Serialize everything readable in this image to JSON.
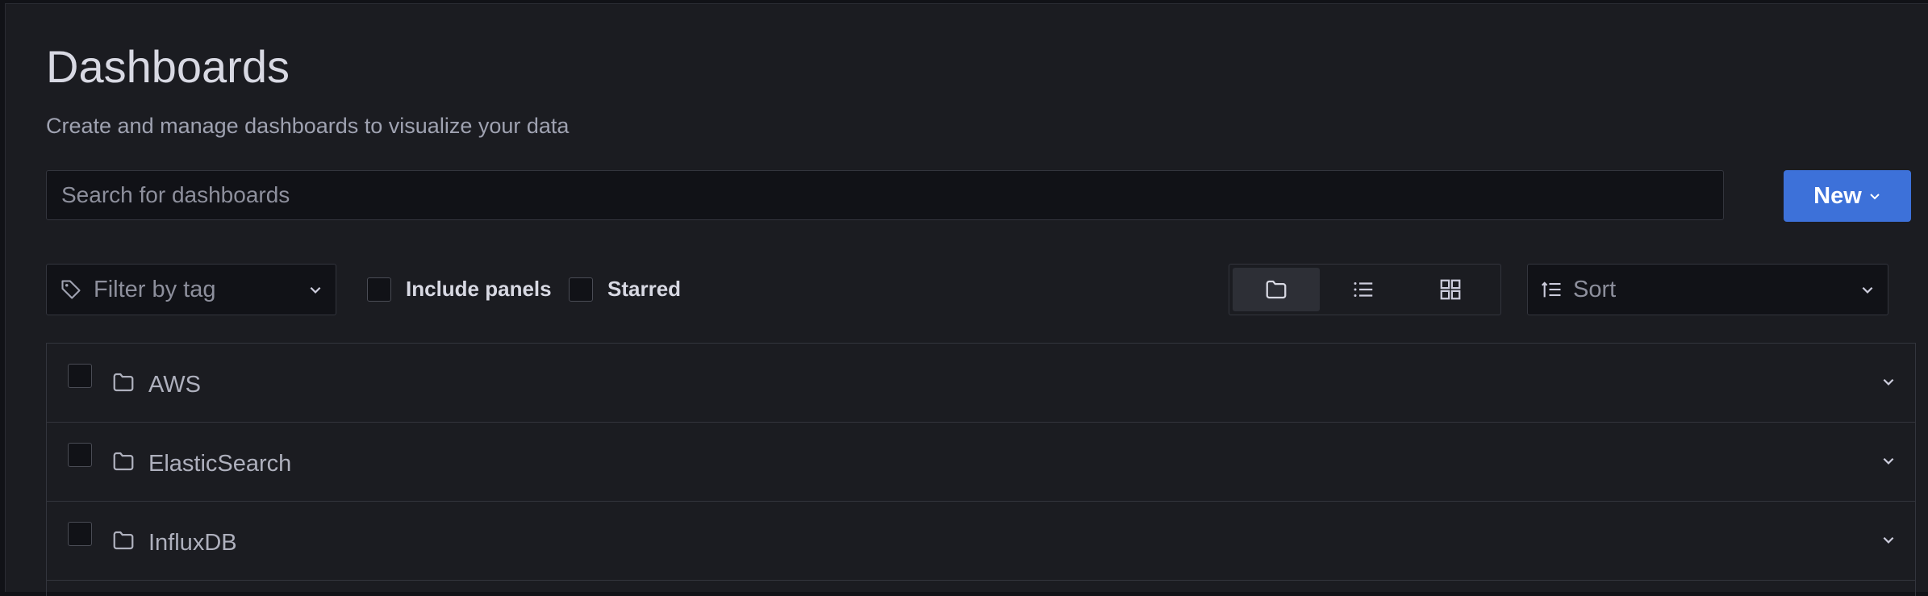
{
  "header": {
    "title": "Dashboards",
    "subtitle": "Create and manage dashboards to visualize your data"
  },
  "search": {
    "placeholder": "Search for dashboards",
    "value": ""
  },
  "new_button": {
    "label": "New",
    "icon": "chevron-down-icon",
    "color": "#3d71d9"
  },
  "filters": {
    "tag_placeholder": "Filter by tag",
    "include_panels_label": "Include panels",
    "include_panels_checked": false,
    "starred_label": "Starred",
    "starred_checked": false
  },
  "view_toggle": {
    "options": [
      {
        "name": "folder-view",
        "icon": "folder-icon",
        "active": true
      },
      {
        "name": "list-view",
        "icon": "list-icon",
        "active": false
      },
      {
        "name": "grid-view",
        "icon": "grid-icon",
        "active": false
      }
    ]
  },
  "sort": {
    "placeholder": "Sort",
    "icon": "sort-icon"
  },
  "folders": [
    {
      "name": "AWS"
    },
    {
      "name": "ElasticSearch"
    },
    {
      "name": "InfluxDB"
    }
  ]
}
